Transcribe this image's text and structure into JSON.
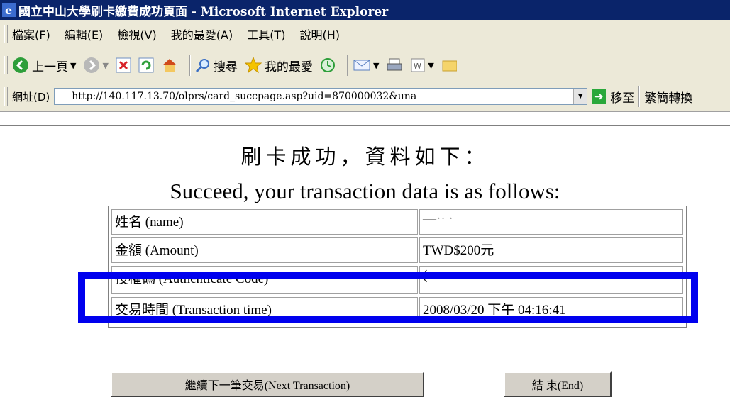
{
  "window": {
    "title": "國立中山大學刷卡繳費成功頁面 - Microsoft Internet Explorer"
  },
  "menu": {
    "items": [
      "檔案(F)",
      "編輯(E)",
      "檢視(V)",
      "我的最愛(A)",
      "工具(T)",
      "說明(H)"
    ]
  },
  "toolbar": {
    "back_label": "上一頁",
    "search_label": "搜尋",
    "favorites_label": "我的最愛"
  },
  "address": {
    "label": "網址(D)",
    "url": "http://140.117.13.70/olprs/card_succpage.asp?uid=870000032&una",
    "go_label": "移至",
    "convert_label": "繁簡轉換"
  },
  "page": {
    "heading_zh": "刷卡成功，資料如下：",
    "heading_en": "Succeed, your transaction data is as follows:",
    "rows": [
      {
        "label": "姓名 (name)",
        "value": "—·· ·"
      },
      {
        "label": "金額 (Amount)",
        "value": "TWD$200元"
      },
      {
        "label": "授權碼 (Authenticate Code)",
        "value": "("
      },
      {
        "label": "交易時間 (Transaction time)",
        "value": "2008/03/20 下午 04:16:41"
      }
    ],
    "next_button": "繼續下一筆交易(Next Transaction)",
    "end_button": "結 束(End)"
  },
  "colors": {
    "titlebar": "#0a246a",
    "chrome": "#ece9d8",
    "highlight": "#0000ee"
  }
}
